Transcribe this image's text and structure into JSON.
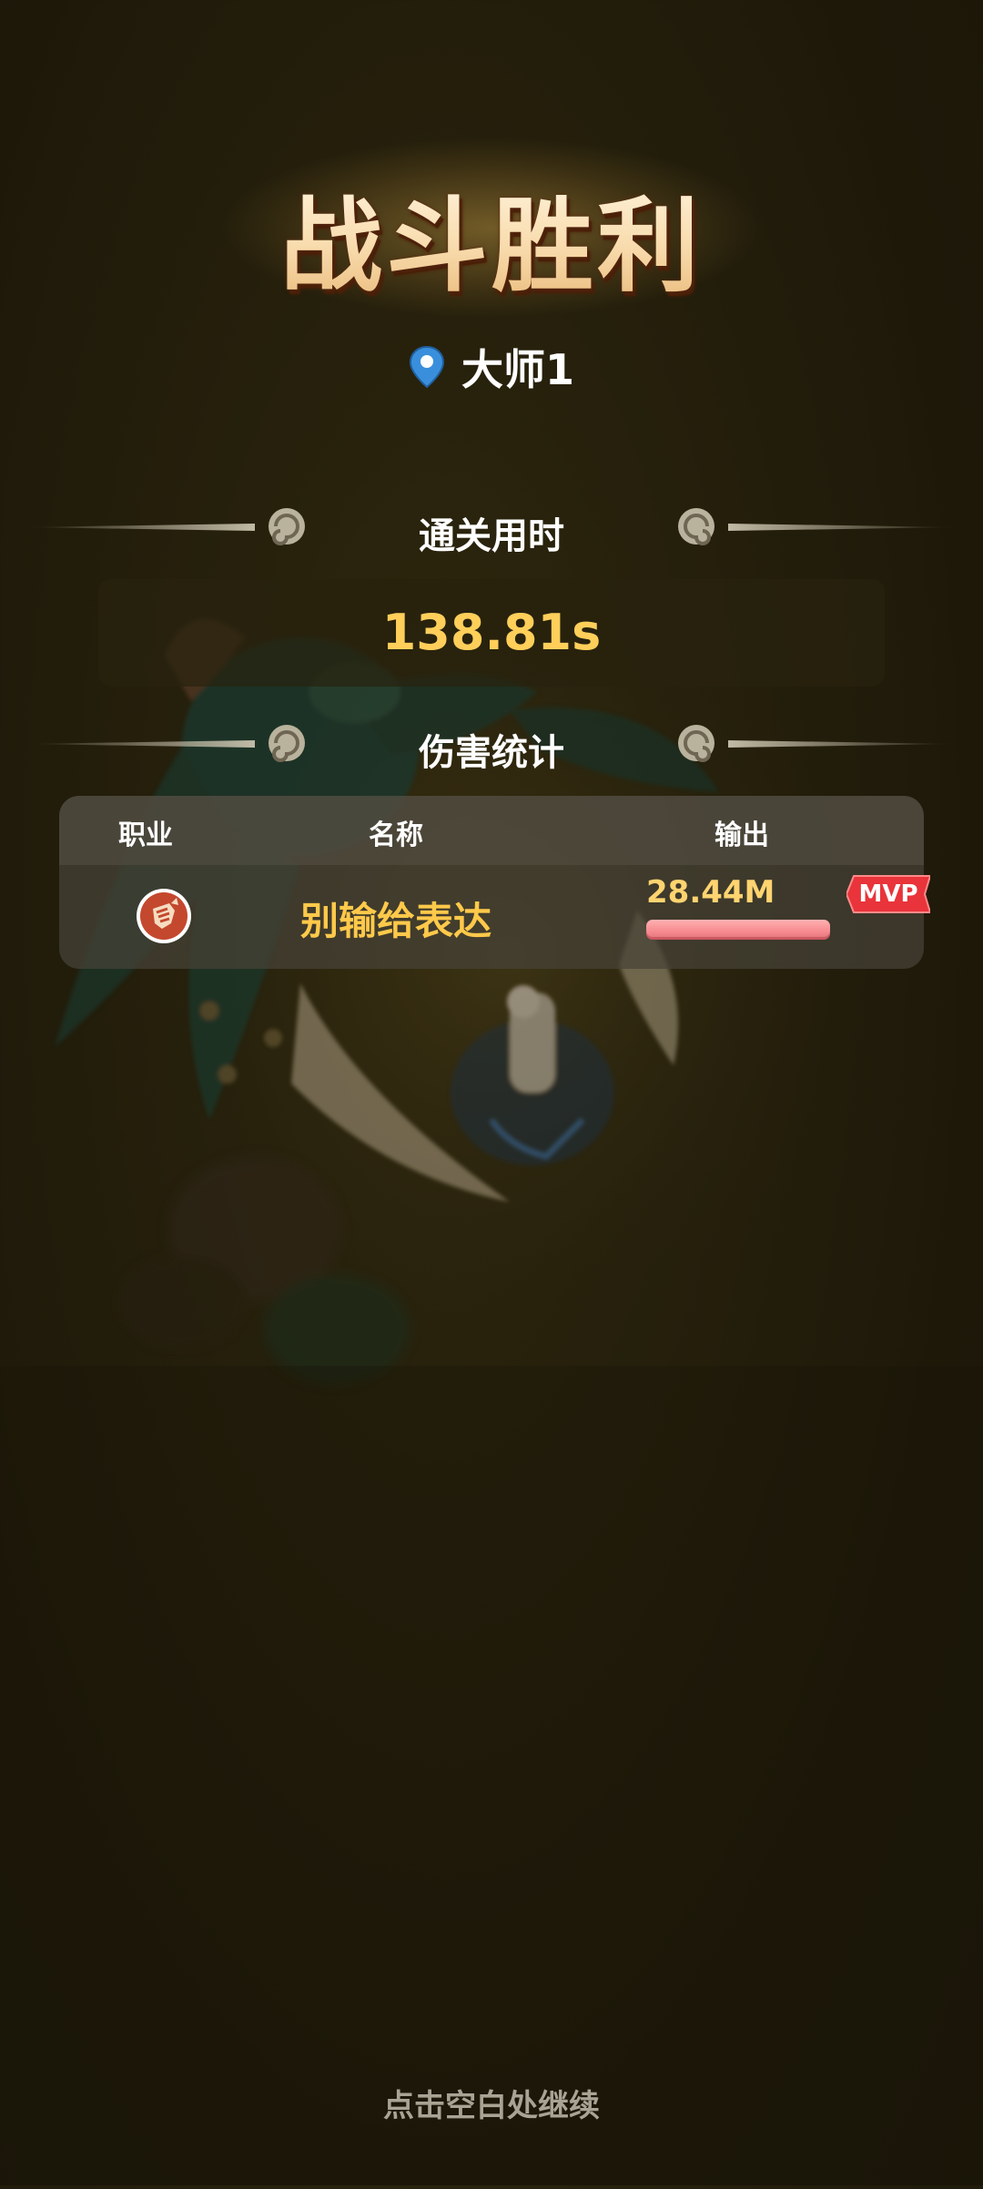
{
  "result": {
    "title": "战斗胜利",
    "stage_label": "大师1",
    "stage_icon": "location-pin-icon"
  },
  "clear_time": {
    "header": "通关用时",
    "value": "138.81s"
  },
  "damage_stats": {
    "header": "伤害统计",
    "columns": {
      "class": "职业",
      "name": "名称",
      "output": "输出"
    },
    "rows": [
      {
        "class_icon": "fist-class-icon",
        "name": "别输给表达",
        "output": "28.44M",
        "output_share": 1.0,
        "badge": "MVP"
      }
    ]
  },
  "footer": {
    "hint": "点击空白处继续"
  },
  "colors": {
    "title": "#fde9c6",
    "accent_gold": "#ffc94a",
    "mvp_red": "#e8343a",
    "bar_pink": "#f58a8f",
    "background": "#2c2710"
  }
}
